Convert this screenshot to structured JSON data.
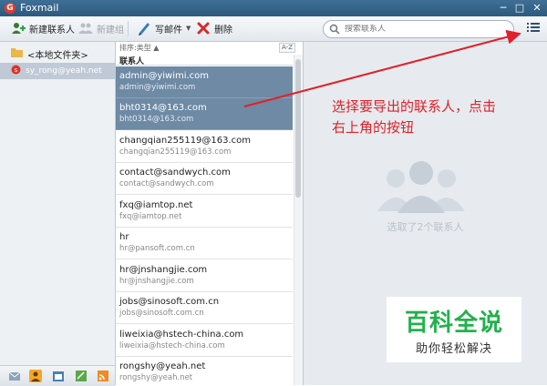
{
  "window": {
    "title": "Foxmail",
    "controls": [
      "─",
      "□",
      "✕"
    ]
  },
  "toolbar": {
    "new_contact_label": "新建联系人",
    "new_group_label": "新建组",
    "compose_label": "写邮件",
    "delete_label": "删除",
    "search_placeholder": "搜索联系人"
  },
  "sidebar": {
    "folder_label": "<本地文件夹>",
    "account_label": "sy_rong@yeah.net"
  },
  "list": {
    "sort_label": "排序:类型 ▲",
    "az_label": "A-Z",
    "group_header": "联系人",
    "contacts": [
      {
        "name": "admin@yiwimi.com",
        "email": "admin@yiwimi.com",
        "selected": true
      },
      {
        "name": "bht0314@163.com",
        "email": "bht0314@163.com",
        "selected": true
      },
      {
        "name": "changqian255119@163.com",
        "email": "changqian255119@163.com",
        "selected": false
      },
      {
        "name": "contact@sandwych.com",
        "email": "contact@sandwych.com",
        "selected": false
      },
      {
        "name": "fxq@iamtop.net",
        "email": "fxq@iamtop.net",
        "selected": false
      },
      {
        "name": "hr",
        "email": "hr@pansoft.com.cn",
        "selected": false
      },
      {
        "name": "hr@jnshangjie.com",
        "email": "hr@jnshangjie.com",
        "selected": false
      },
      {
        "name": "jobs@sinosoft.com.cn",
        "email": "jobs@sinosoft.com.cn",
        "selected": false
      },
      {
        "name": "liweixia@hstech-china.com",
        "email": "liweixia@hstech-china.com",
        "selected": false
      },
      {
        "name": "rongshy@yeah.net",
        "email": "rongshy@yeah.net",
        "selected": false
      }
    ]
  },
  "detail": {
    "annotation_line1": "选择要导出的联系人，点击",
    "annotation_line2": "右上角的按钮",
    "selection_text": "选取了2个联系人"
  },
  "watermark": {
    "line1": "百科全说",
    "line2": "助你轻松解决"
  },
  "colors": {
    "titlebar": "#2d5a7f",
    "selected_row": "#6e8aa5",
    "annotation": "#e0202a",
    "logo_green": "#22b14c"
  }
}
